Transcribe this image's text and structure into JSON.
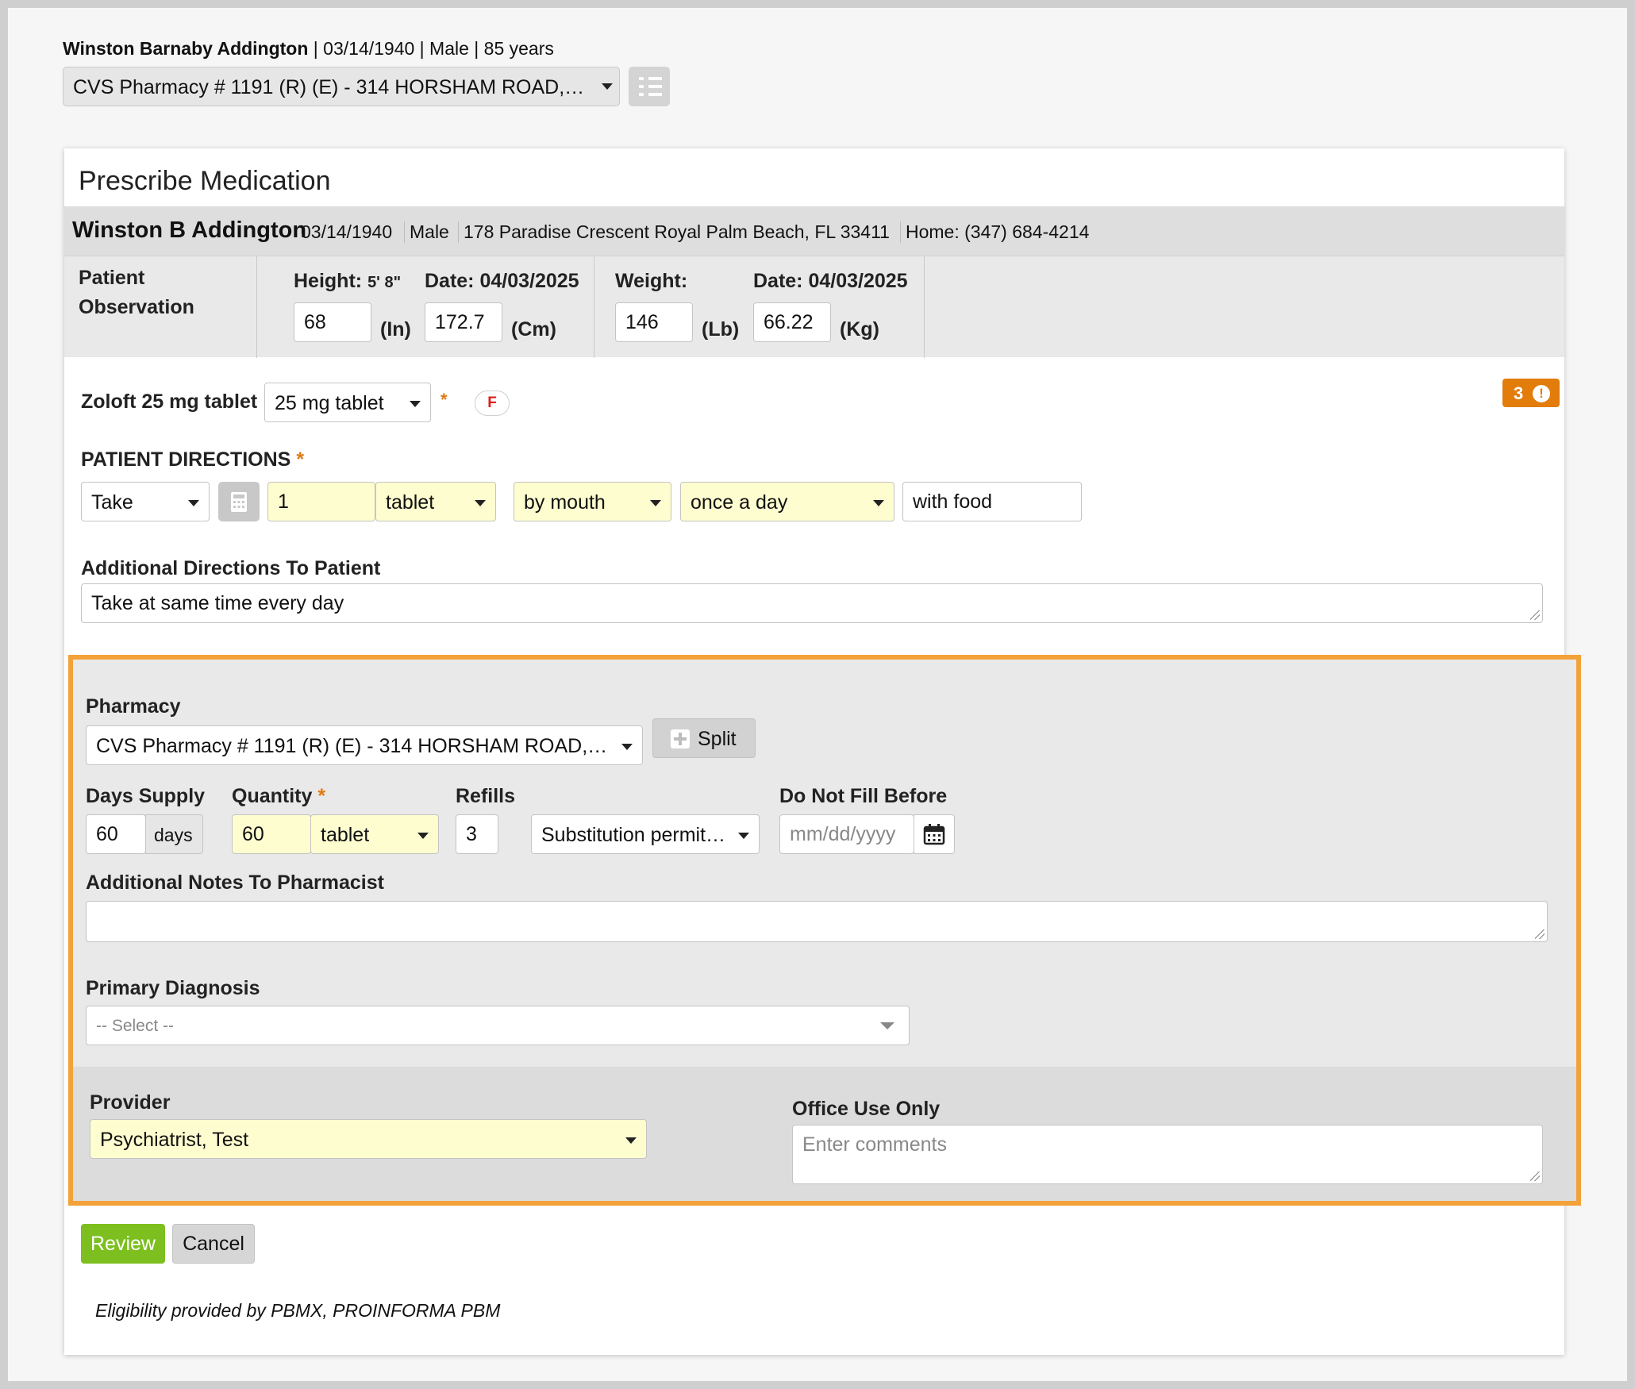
{
  "header": {
    "patient_name": "Winston Barnaby Addington",
    "patient_meta": " | 03/14/1940 | Male | 85 years",
    "pharmacy_select": "CVS Pharmacy # 1191 (R) (E) - 314 HORSHAM ROAD,…"
  },
  "card": {
    "title": "Prescribe Medication",
    "demographics": {
      "name": "Winston B Addington",
      "dob": "03/14/1940",
      "sex": "Male",
      "address": "178 Paradise Crescent Royal Palm Beach, FL 33411",
      "phone": "Home: (347) 684-4214"
    },
    "observation": {
      "label_line1": "Patient",
      "label_line2": "Observation",
      "height_label": "Height:",
      "height_display": "5' 8\"",
      "height_date": "Date: 04/03/2025",
      "height_in": "68",
      "height_in_unit": "(In)",
      "height_cm": "172.7",
      "height_cm_unit": "(Cm)",
      "weight_label": "Weight:",
      "weight_date": "Date: 04/03/2025",
      "weight_lb": "146",
      "weight_lb_unit": "(Lb)",
      "weight_kg": "66.22",
      "weight_kg_unit": "(Kg)"
    },
    "medication": {
      "name": "Zoloft 25 mg tablet",
      "form_select": "25 mg tablet",
      "required_mark": "*",
      "formulary_pill": "F",
      "alert_count": "3",
      "alert_icon": "!"
    },
    "directions": {
      "label": "PATIENT DIRECTIONS",
      "required_mark": "*",
      "verb": "Take",
      "dose": "1",
      "unit": "tablet",
      "route": "by mouth",
      "frequency": "once a day",
      "extra": "with food"
    },
    "additional_directions": {
      "label": "Additional Directions To Patient",
      "value": "Take at same time every day"
    }
  },
  "fulfillment": {
    "pharmacy_label": "Pharmacy",
    "pharmacy_select": "CVS Pharmacy # 1191 (R) (E) - 314 HORSHAM ROAD,…",
    "split_label": "Split",
    "days_supply_label": "Days Supply",
    "days_supply": "60",
    "days_unit": "days",
    "quantity_label": "Quantity",
    "quantity_required": "*",
    "quantity": "60",
    "quantity_unit": "tablet",
    "refills_label": "Refills",
    "refills": "3",
    "substitution": "Substitution permit…",
    "dnfb_label": "Do Not Fill Before",
    "dnfb_placeholder": "mm/dd/yyyy",
    "notes_label": "Additional Notes To Pharmacist",
    "notes_value": "",
    "diagnosis_label": "Primary Diagnosis",
    "diagnosis_placeholder": "-- Select --",
    "provider_label": "Provider",
    "provider_value": "Psychiatrist, Test",
    "office_label": "Office Use Only",
    "office_placeholder": "Enter comments"
  },
  "actions": {
    "review": "Review",
    "cancel": "Cancel"
  },
  "footer": {
    "eligibility": "Eligibility provided by PBMX, PROINFORMA PBM"
  },
  "colors": {
    "highlight_border": "#f3a23a",
    "review_green": "#7cbf1f",
    "alert_orange": "#e27c0b",
    "required_field_yellow": "#fefdd0"
  },
  "icons": [
    "chevron-down-icon",
    "list-icon",
    "calculator-icon",
    "plus-icon",
    "calendar-icon",
    "alert-icon",
    "resize-grip-icon"
  ]
}
